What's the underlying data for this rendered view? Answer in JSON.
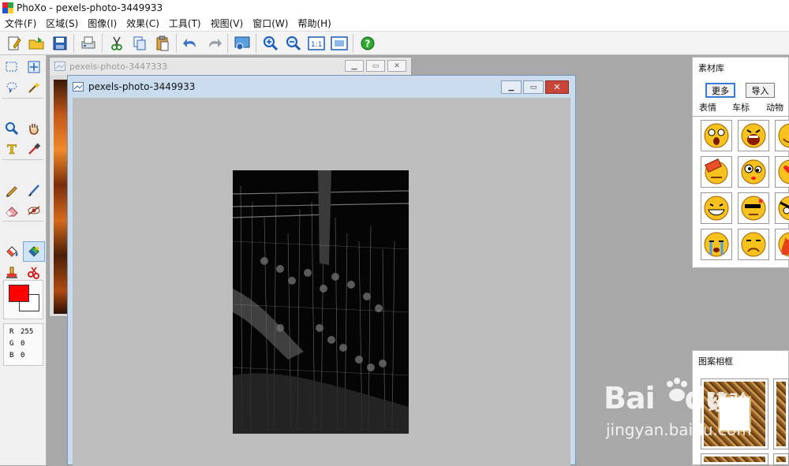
{
  "window": {
    "title": "PhoXo - pexels-photo-3449933"
  },
  "menu": [
    {
      "label": "文件(F)"
    },
    {
      "label": "区域(S)"
    },
    {
      "label": "图像(I)"
    },
    {
      "label": "效果(C)"
    },
    {
      "label": "工具(T)"
    },
    {
      "label": "视图(V)"
    },
    {
      "label": "窗口(W)"
    },
    {
      "label": "帮助(H)"
    }
  ],
  "toolbar": [
    {
      "name": "new-icon"
    },
    {
      "name": "open-icon"
    },
    {
      "name": "save-icon"
    },
    {
      "sep": true
    },
    {
      "name": "scan-icon"
    },
    {
      "sep": true
    },
    {
      "name": "cut-icon"
    },
    {
      "name": "copy-icon"
    },
    {
      "name": "paste-icon"
    },
    {
      "sep": true
    },
    {
      "name": "undo-icon"
    },
    {
      "name": "redo-icon"
    },
    {
      "sep": true
    },
    {
      "name": "batch-icon"
    },
    {
      "sep": true
    },
    {
      "name": "zoom-in-icon"
    },
    {
      "name": "zoom-out-icon"
    },
    {
      "name": "actual-size-icon"
    },
    {
      "name": "fit-window-icon"
    },
    {
      "sep": true
    },
    {
      "name": "help-icon"
    }
  ],
  "tools": [
    "rect-select-icon",
    "move-icon",
    "lasso-icon",
    "magic-wand-icon",
    "zoom-icon",
    "hand-icon",
    "text-icon",
    "eyedropper-icon",
    "pencil-icon",
    "brush-icon",
    "eraser-icon",
    "red-eye-icon",
    "fill-icon",
    "color-replace-icon",
    "stamp-icon",
    "clone-icon",
    "gradient-icon",
    "line-icon",
    "transform-icon",
    "star-icon"
  ],
  "colors": {
    "foreground": "#ff0000",
    "background": "#ffffff"
  },
  "rgb": {
    "r_label": "R",
    "r": "255",
    "g_label": "G",
    "g": "0",
    "b_label": "B",
    "b": "0"
  },
  "back_doc": {
    "title": "pexels-photo-3447333"
  },
  "front_doc": {
    "title": "pexels-photo-3449933"
  },
  "material_panel": {
    "title": "素材库",
    "more_label": "更多",
    "import_label": "导入",
    "tabs": [
      {
        "label": "表情"
      },
      {
        "label": "车标"
      },
      {
        "label": "动物"
      }
    ],
    "items": [
      "shocked-emoji-icon",
      "screaming-emoji-icon",
      "smile-emoji-icon",
      "eraser-emoji-icon",
      "dizzy-emoji-icon",
      "hearts-emoji-icon",
      "grin-emoji-icon",
      "angry-emoji-icon",
      "evil-emoji-icon",
      "crying-emoji-icon",
      "sad-emoji-icon",
      "fire-emoji-icon"
    ]
  },
  "frame_panel": {
    "title": "图案相框"
  },
  "watermark": {
    "brand": "Bai",
    "brand2": "du",
    "sub": "经验",
    "url": "jingyan.baidu.com"
  }
}
